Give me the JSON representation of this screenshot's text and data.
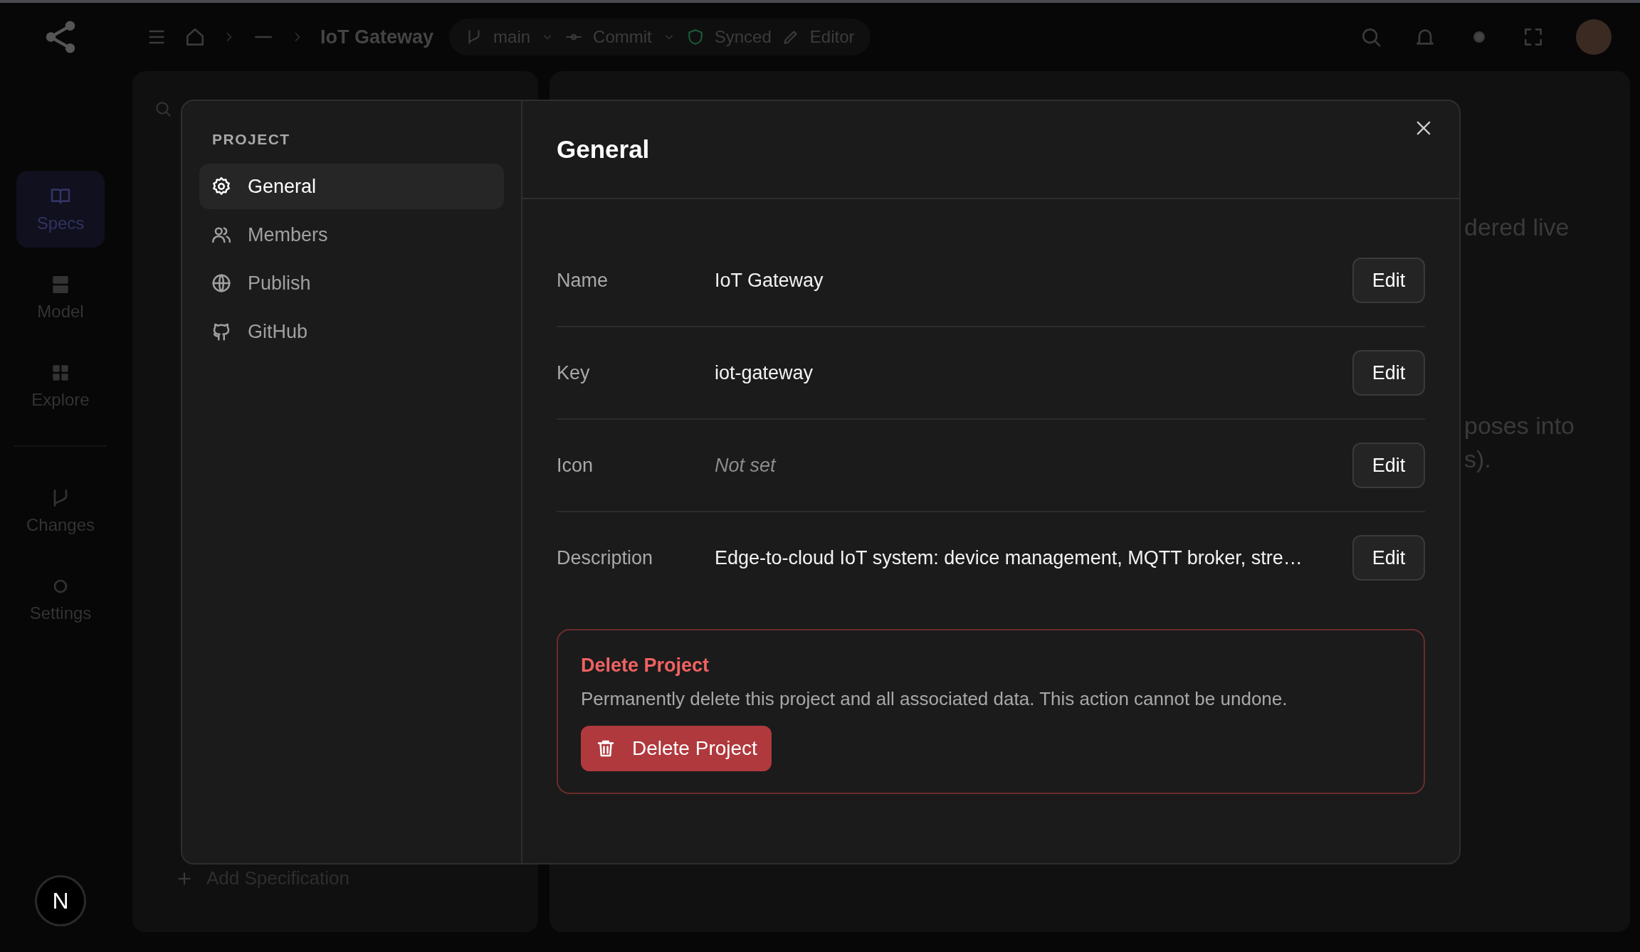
{
  "topbar": {
    "breadcrumb": "IoT Gateway",
    "branch": "main",
    "commit": "Commit",
    "sync": "Synced",
    "mode": "Editor"
  },
  "rail": {
    "items": [
      {
        "label": "Specs",
        "selected": true
      },
      {
        "label": "Model",
        "selected": false
      },
      {
        "label": "Explore",
        "selected": false
      },
      {
        "label": "Changes",
        "selected": false
      },
      {
        "label": "Settings",
        "selected": false
      }
    ],
    "badge": "N"
  },
  "spec_panel": {
    "add_label": "Add Specification"
  },
  "content_fragments": [
    "dered live",
    "poses into",
    "s)."
  ],
  "modal": {
    "section_label": "PROJECT",
    "nav": [
      {
        "label": "General",
        "selected": true
      },
      {
        "label": "Members",
        "selected": false
      },
      {
        "label": "Publish",
        "selected": false
      },
      {
        "label": "GitHub",
        "selected": false
      }
    ],
    "title": "General",
    "fields": [
      {
        "label": "Name",
        "value": "IoT Gateway",
        "empty": false,
        "action": "Edit"
      },
      {
        "label": "Key",
        "value": "iot-gateway",
        "empty": false,
        "action": "Edit"
      },
      {
        "label": "Icon",
        "value": "Not set",
        "empty": true,
        "action": "Edit"
      },
      {
        "label": "Description",
        "value": "Edge-to-cloud IoT system: device management, MQTT broker, stre…",
        "empty": false,
        "action": "Edit"
      }
    ],
    "danger": {
      "title": "Delete Project",
      "text": "Permanently delete this project and all associated data. This action cannot be undone.",
      "button": "Delete Project"
    }
  }
}
